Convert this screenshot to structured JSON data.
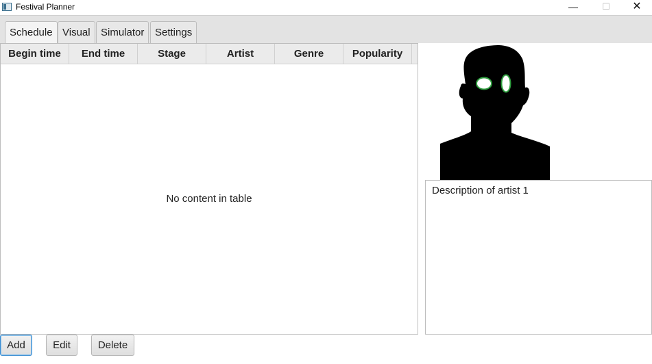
{
  "window": {
    "title": "Festival Planner",
    "minimize_glyph": "—",
    "maximize_glyph": "☐",
    "close_glyph": "✕"
  },
  "tabs": [
    {
      "label": "Schedule",
      "active": true
    },
    {
      "label": "Visual",
      "active": false
    },
    {
      "label": "Simulator",
      "active": false
    },
    {
      "label": "Settings",
      "active": false
    }
  ],
  "table": {
    "columns": [
      "Begin time",
      "End time",
      "Stage",
      "Artist",
      "Genre",
      "Popularity"
    ],
    "rows": [],
    "empty_message": "No content in table"
  },
  "artist_panel": {
    "image_icon": "person-silhouette-icon",
    "description": "Description of artist 1"
  },
  "actions": {
    "add_label": "Add",
    "edit_label": "Edit",
    "delete_label": "Delete"
  },
  "colors": {
    "focus_border": "#3c8ed3",
    "silhouette": "#000000",
    "eye_outline": "#2e9e3e"
  }
}
